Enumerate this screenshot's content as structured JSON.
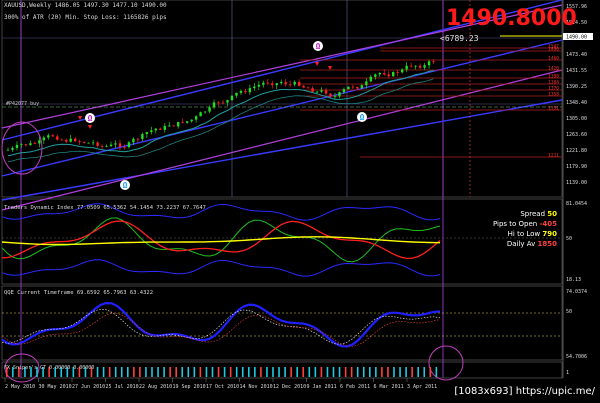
{
  "colors": {
    "background": "#000000",
    "grid": "#5a5a8c",
    "channel_blue": "#3a3aff",
    "channel_violet": "#b040e0",
    "bull_candle": "#22dd22",
    "bear_candle": "#ff2020",
    "price_big": "#ff1a1a",
    "tdi_green": "#20c020",
    "tdi_red": "#ff2020",
    "tdi_yellow": "#ffff00",
    "qqe_blue": "#2020ff",
    "level_red": "#b02020"
  },
  "main_panel": {
    "header_line1": "XAUUSD,Weekly  1486.05 1497.30 1477.10 1490.00",
    "header_line2": "300% of ATR (20)    Min. Stop Loss:  1165826 pips",
    "big_price": "1490.8000",
    "price_note": "6789.23",
    "left_label": "#P42077 buy",
    "price_axis": [
      "1557.96",
      "1514.50",
      "1490.00",
      "1473.40",
      "1431.55",
      "1390.25",
      "1348.40",
      "1305.00",
      "1263.60",
      "1221.80",
      "1179.90",
      "1139.00"
    ],
    "level_labels": [
      "1547",
      "1490",
      "1460",
      "1420",
      "1398",
      "1384",
      "1370",
      "1358",
      "1331",
      "1211"
    ],
    "markers": {
      "magenta_top": "Ω",
      "blue_bottom": "Ω",
      "cyan_bottom": "Ω",
      "magenta_left": "Ω"
    }
  },
  "tdi_panel": {
    "header": "Traders Dynamic Index 77.0509 65.5362 54.1454 73.2237 67.7647",
    "axis_labels": [
      "81.0454",
      "50",
      "18.13"
    ],
    "stats": [
      {
        "label": "Spread",
        "value": "50",
        "color": "#ffff00"
      },
      {
        "label": "Pips to Open",
        "value": "-405",
        "color": "#ff4040"
      },
      {
        "label": "Hi to Low",
        "value": "790",
        "color": "#ffff00"
      },
      {
        "label": "Daily Av",
        "value": "1850",
        "color": "#ff4040"
      }
    ]
  },
  "qqe_panel": {
    "header": "QQE Current Timeframe 69.6592 65.7963 63.4322",
    "axis_labels": [
      "74.0374",
      "50",
      "54.7006"
    ]
  },
  "bottom_panel": {
    "header": "FX Sniper's GT 0.00000 0.00000",
    "axis_labels": [
      "1"
    ]
  },
  "time_axis": [
    "2 May 2010",
    "30 May 2010",
    "27 Jun 2010",
    "25 Jul 2010",
    "22 Aug 2010",
    "19 Sep 2010",
    "17 Oct 2010",
    "14 Nov 2010",
    "12 Dec 2010",
    "9 Jan 2011",
    "6 Feb 2011",
    "6 Mar 2011",
    "3 Apr 2011"
  ],
  "watermark": "[1083x693] https://upic.me/"
}
